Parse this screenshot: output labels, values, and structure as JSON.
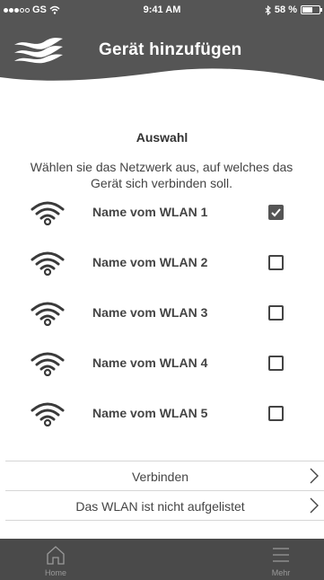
{
  "status_bar": {
    "carrier": "GS",
    "time": "9:41 AM",
    "battery": "58 %",
    "battery_level_percent": 58,
    "icons": [
      "signal-dots-icon",
      "wifi-status-icon",
      "bluetooth-icon",
      "battery-icon"
    ]
  },
  "header": {
    "title": "Gerät hinzufügen",
    "logo_icon": "wave-logo-icon",
    "background_color": "#555555"
  },
  "main": {
    "section_title": "Auswahl",
    "instructions": "Wählen sie das Netzwerk aus, auf welches das Gerät sich verbinden soll.",
    "networks": [
      {
        "name": "Name vom WLAN 1",
        "checked": true,
        "icon": "wifi-icon"
      },
      {
        "name": "Name vom WLAN 2",
        "checked": false,
        "icon": "wifi-icon"
      },
      {
        "name": "Name vom WLAN 3",
        "checked": false,
        "icon": "wifi-icon"
      },
      {
        "name": "Name vom WLAN 4",
        "checked": false,
        "icon": "wifi-icon"
      },
      {
        "name": "Name vom WLAN 5",
        "checked": false,
        "icon": "wifi-icon"
      }
    ]
  },
  "actions": {
    "connect_label": "Verbinden",
    "not_listed_label": "Das WLAN ist nicht aufgelistet",
    "chevron_icon": "chevron-right-icon"
  },
  "tab_bar": {
    "home_label": "Home",
    "home_icon": "home-icon",
    "more_label": "Mehr",
    "more_icon": "menu-icon",
    "background_color": "#4a4a4a"
  }
}
